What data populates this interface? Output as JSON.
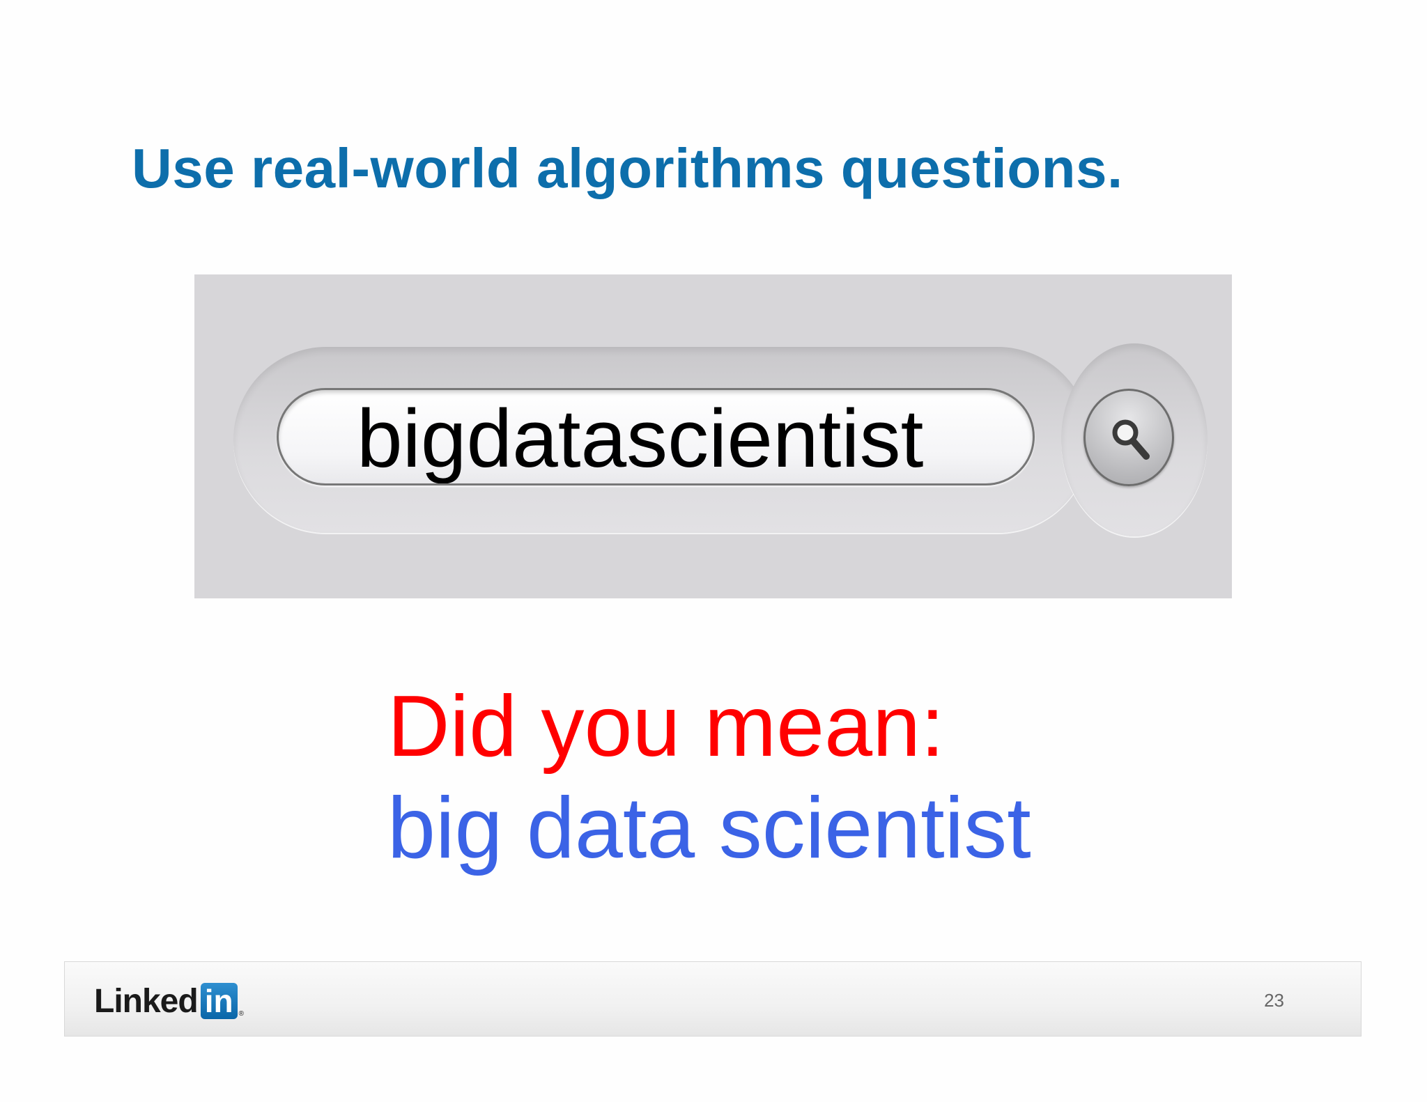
{
  "slide": {
    "title": "Use real-world algorithms questions.",
    "search_box": {
      "query": "bigdatascientist"
    },
    "suggestion": {
      "prompt": "Did you mean:",
      "corrected_query": "big data scientist"
    },
    "footer": {
      "logo": {
        "text": "Linked",
        "badge": "in",
        "registered": "®"
      },
      "page_number": "23"
    },
    "colors": {
      "title": "#0d6eab",
      "prompt": "#ff0000",
      "suggestion": "#3b63e6"
    },
    "icons": {
      "search_button": "magnifier-icon"
    }
  }
}
